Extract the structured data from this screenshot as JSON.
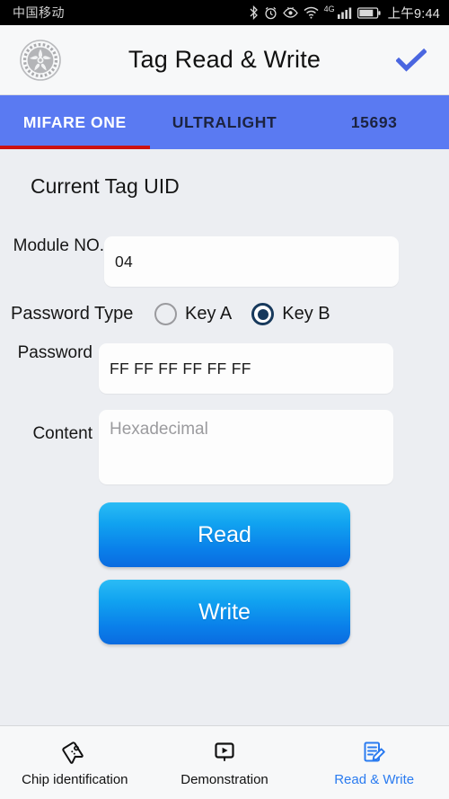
{
  "statusbar": {
    "carrier": "中国移动",
    "time": "上午9:44",
    "network_label": "4G",
    "icons": [
      "bluetooth-icon",
      "alarm-icon",
      "eye-icon",
      "wifi-icon",
      "signal-bars-icon",
      "battery-icon"
    ]
  },
  "header": {
    "settings_icon": "gear-icon",
    "title": "Tag Read & Write",
    "confirm_icon": "check-icon",
    "accent_color": "#4a66e0"
  },
  "tabs": {
    "items": [
      {
        "label": "MIFARE ONE",
        "active": true
      },
      {
        "label": "ULTRALIGHT",
        "active": false
      },
      {
        "label": "15693",
        "active": false
      }
    ],
    "bar_color": "#5a7af2",
    "indicator_color": "#cc1111"
  },
  "main": {
    "section_title": "Current Tag UID",
    "module": {
      "label": "Module NO.",
      "value": "04"
    },
    "password_type": {
      "label": "Password Type",
      "options": [
        {
          "label": "Key A",
          "selected": false
        },
        {
          "label": "Key B",
          "selected": true
        }
      ],
      "selected_color": "#17395c"
    },
    "password": {
      "label": "Password",
      "value": "FF FF FF FF FF FF"
    },
    "content": {
      "label": "Content",
      "value": "",
      "placeholder": "Hexadecimal"
    },
    "read_button": "Read",
    "write_button": "Write",
    "button_color": "#0a80ea"
  },
  "bottomnav": {
    "items": [
      {
        "label": "Chip identification",
        "icon": "tag-icon",
        "active": false
      },
      {
        "label": "Demonstration",
        "icon": "presentation-play-icon",
        "active": false
      },
      {
        "label": "Read & Write",
        "icon": "document-pencil-icon",
        "active": true
      }
    ],
    "active_color": "#2a7bf0"
  }
}
